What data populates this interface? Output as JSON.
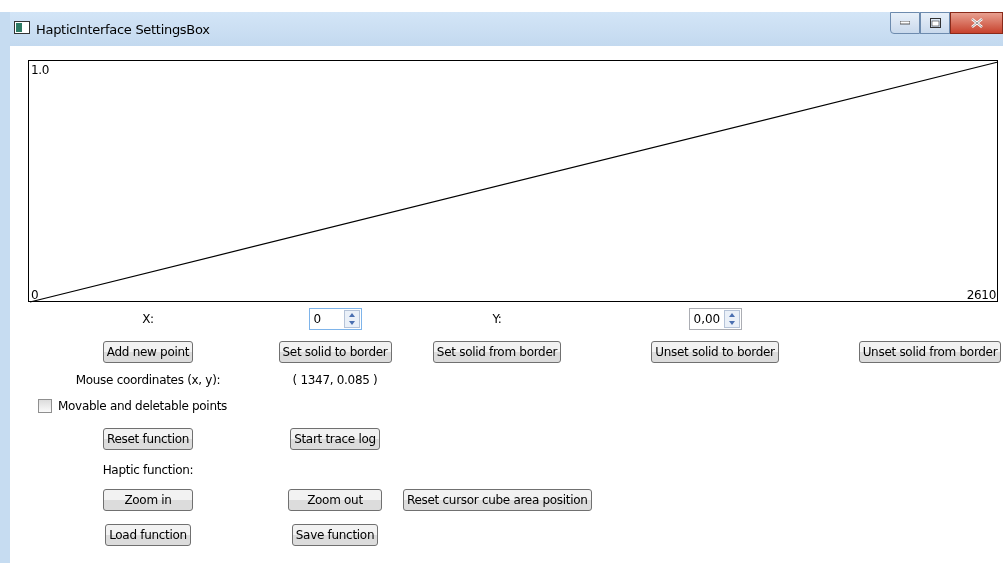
{
  "window": {
    "title": "HapticInterface SettingsBox"
  },
  "plot": {
    "y_max_label": "1.0",
    "origin_label": "0",
    "x_max_label": "2610"
  },
  "x_field": {
    "label": "X:",
    "value": "0"
  },
  "y_field": {
    "label": "Y:",
    "value": "0,00"
  },
  "solid_buttons": [
    "Add new point",
    "Set solid to border",
    "Set solid from border",
    "Unset solid to border",
    "Unset solid from border"
  ],
  "mouse": {
    "label": "Mouse coordinates (x, y):",
    "value": "( 1347, 0.085 )"
  },
  "movable_points": {
    "label": "Movable and deletable points",
    "checked": false
  },
  "function_buttons": [
    "Reset function",
    "Start trace log"
  ],
  "haptic_label": "Haptic function:",
  "zoom_buttons": [
    "Zoom in",
    "Zoom out",
    "Reset cursor cube area position"
  ],
  "file_buttons": [
    "Load function",
    "Save function"
  ]
}
